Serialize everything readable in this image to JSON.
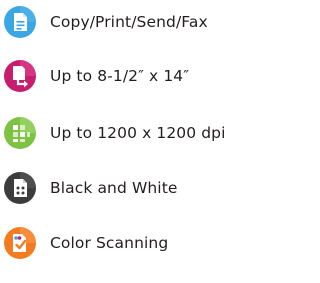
{
  "features": [
    {
      "label": "Copy/Print/Send/Fax",
      "icon": "document-icon",
      "color": "#3aa6e3"
    },
    {
      "label": "Up to 8-1/2″ x 14″",
      "icon": "paper-feed-icon",
      "color": "#c81d6e"
    },
    {
      "label": "Up to 1200 x 1200 dpi",
      "icon": "pixel-grid-icon",
      "color": "#7dc242"
    },
    {
      "label": "Black and White",
      "icon": "monochrome-document-icon",
      "color": "#3c3c3c"
    },
    {
      "label": "Color Scanning",
      "icon": "color-scan-icon",
      "color": "#f47b20"
    }
  ]
}
